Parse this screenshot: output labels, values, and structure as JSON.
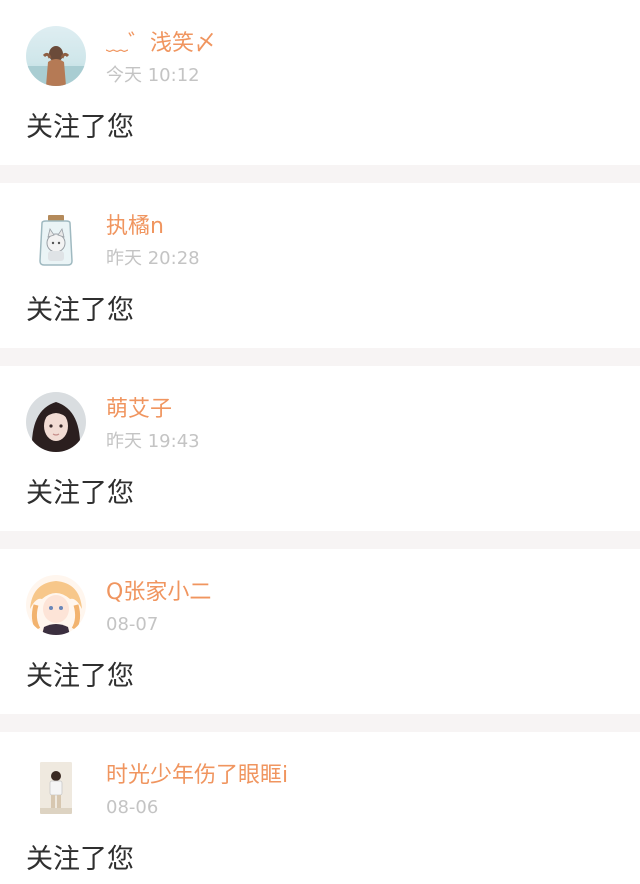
{
  "notifications": [
    {
      "avatar": "avatar-beach-girl",
      "name": "﹏゛浅笑〆",
      "time": "今天 10:12",
      "message": "关注了您"
    },
    {
      "avatar": "avatar-cat-in-jar",
      "name": "执橘n",
      "time": "昨天 20:28",
      "message": "关注了您"
    },
    {
      "avatar": "avatar-dark-hair-girl",
      "name": "萌艾子",
      "time": "昨天 19:43",
      "message": "关注了您"
    },
    {
      "avatar": "avatar-anime-girl",
      "name": "Q张家小二",
      "time": "08-07",
      "message": "关注了您"
    },
    {
      "avatar": "avatar-boy-standing",
      "name": "时光少年伤了眼眶i",
      "time": "08-06",
      "message": "关注了您"
    }
  ],
  "colors": {
    "name": "#f0955f",
    "time": "#c4c4c4",
    "message": "#2f2f2f",
    "separator": "#f7f4f4",
    "card": "#ffffff"
  }
}
